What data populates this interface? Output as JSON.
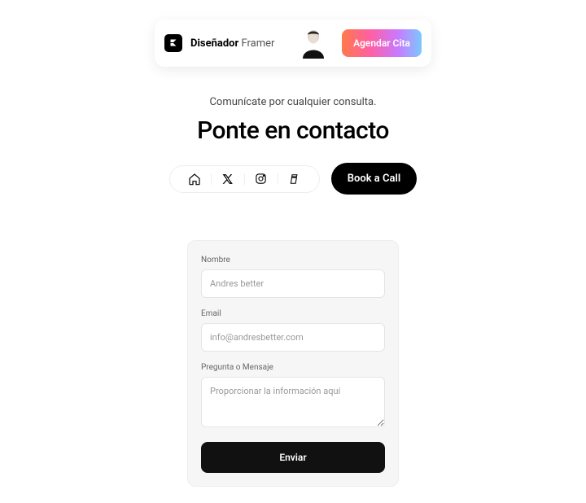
{
  "topbar": {
    "brand_strong": "Diseñador",
    "brand_light": "Framer",
    "cta_label": "Agendar Cita"
  },
  "hero": {
    "subtitle": "Comunícate por cualquier consulta.",
    "title": "Ponte en contacto"
  },
  "nav": {
    "book_call_label": "Book a Call"
  },
  "form": {
    "name_label": "Nombre",
    "name_placeholder": "Andres better",
    "email_label": "Email",
    "email_placeholder": "info@andresbetter.com",
    "message_label": "Pregunta o Mensaje",
    "message_placeholder": "Proporcionar la información aquí",
    "submit_label": "Enviar"
  }
}
